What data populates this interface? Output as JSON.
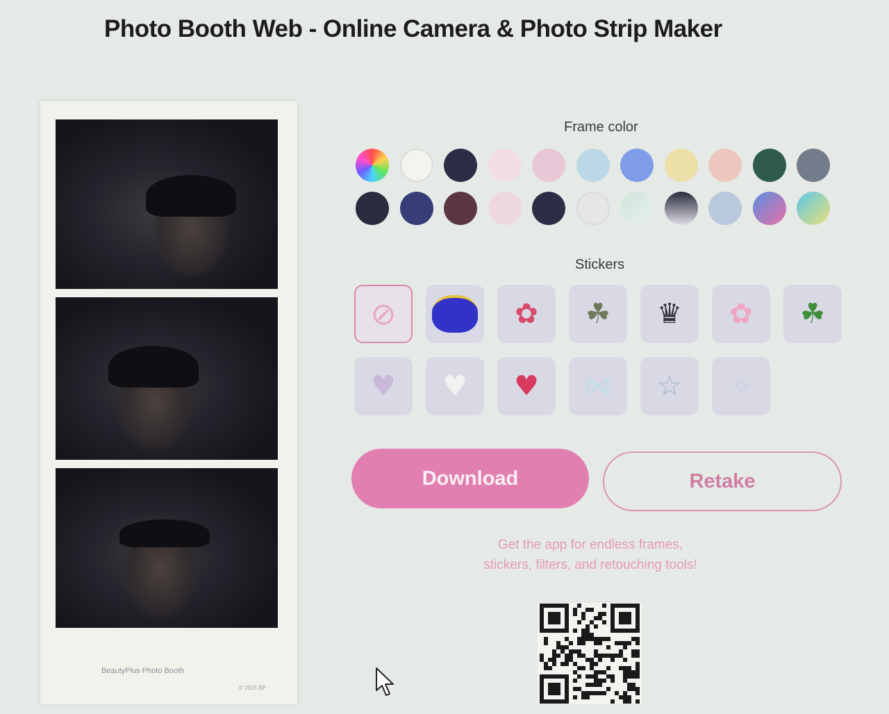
{
  "page": {
    "title": "Photo Booth Web - Online Camera & Photo Strip Maker"
  },
  "strip": {
    "brand": "BeautyPlus Photo Booth",
    "copyright": "© 2025 BP"
  },
  "frame_color": {
    "label": "Frame color",
    "colors": [
      {
        "name": "rainbow-picker",
        "value": "conic-gradient(#ff4d4d,#ffd24d,#5ce65c,#4dd2ff,#6b5cff,#ff4dd2,#ff4d4d)"
      },
      {
        "name": "white",
        "value": "#f3f4f0"
      },
      {
        "name": "navy",
        "value": "#2b2d44"
      },
      {
        "name": "light-pink",
        "value": "#f2dde2"
      },
      {
        "name": "pink",
        "value": "#e8c8d6"
      },
      {
        "name": "light-blue",
        "value": "#bcd8e6"
      },
      {
        "name": "periwinkle",
        "value": "#7e9ce8"
      },
      {
        "name": "light-yellow",
        "value": "#ecdfa8"
      },
      {
        "name": "peach",
        "value": "#ecc7bd"
      },
      {
        "name": "dark-green",
        "value": "#2f5b4c"
      },
      {
        "name": "slate-gray",
        "value": "#737c8a"
      },
      {
        "name": "dark-navy",
        "value": "#2a2b3e"
      },
      {
        "name": "royal-blue",
        "value": "#363d77"
      },
      {
        "name": "maroon",
        "value": "#5b3841"
      },
      {
        "name": "blush",
        "value": "#efd7df"
      },
      {
        "name": "midnight",
        "value": "#2d2e45"
      },
      {
        "name": "off-white",
        "value": "#e6e6e6"
      },
      {
        "name": "mint-gradient",
        "value": "linear-gradient(135deg,#cfe6d8,#e6eef0)"
      },
      {
        "name": "dark-fade",
        "value": "linear-gradient(180deg,#2b2b3b,#dcdde6)"
      },
      {
        "name": "powder-blue",
        "value": "#b9c8dc"
      },
      {
        "name": "aurora",
        "value": "linear-gradient(135deg,#5b8fe0,#e86fa8)"
      },
      {
        "name": "lagoon",
        "value": "linear-gradient(135deg,#5ec5e8,#e8e17a)"
      }
    ]
  },
  "stickers": {
    "label": "Stickers",
    "items": [
      {
        "name": "none",
        "glyph": "⊘",
        "color": "#e6a9c0"
      },
      {
        "name": "blue-cat",
        "glyph": "",
        "color": "#3232c8"
      },
      {
        "name": "flowers",
        "glyph": "✿",
        "color": "#d84a6a"
      },
      {
        "name": "cat-scene",
        "glyph": "☘",
        "color": "#6d7b5a"
      },
      {
        "name": "crown",
        "glyph": "♛",
        "color": "#33333d"
      },
      {
        "name": "pink-flowers",
        "glyph": "✿",
        "color": "#f0a4c0"
      },
      {
        "name": "clover",
        "glyph": "☘",
        "color": "#3f8f3a"
      },
      {
        "name": "crystal-heart",
        "glyph": "♥",
        "color": "#c9b8d8"
      },
      {
        "name": "bubble-heart",
        "glyph": "♥",
        "color": "#f2f2f2"
      },
      {
        "name": "red-hearts",
        "glyph": "♥",
        "color": "#d83a5e"
      },
      {
        "name": "bow",
        "glyph": "⋈",
        "color": "#c6dbe8"
      },
      {
        "name": "stars",
        "glyph": "☆",
        "color": "#9fb7cc"
      },
      {
        "name": "sparkle-shapes",
        "glyph": "✧",
        "color": "#c9d3e0"
      }
    ]
  },
  "actions": {
    "download": "Download",
    "retake": "Retake"
  },
  "promo": {
    "line1": "Get the app for endless frames,",
    "line2": "stickers, filters, and retouching tools!"
  }
}
